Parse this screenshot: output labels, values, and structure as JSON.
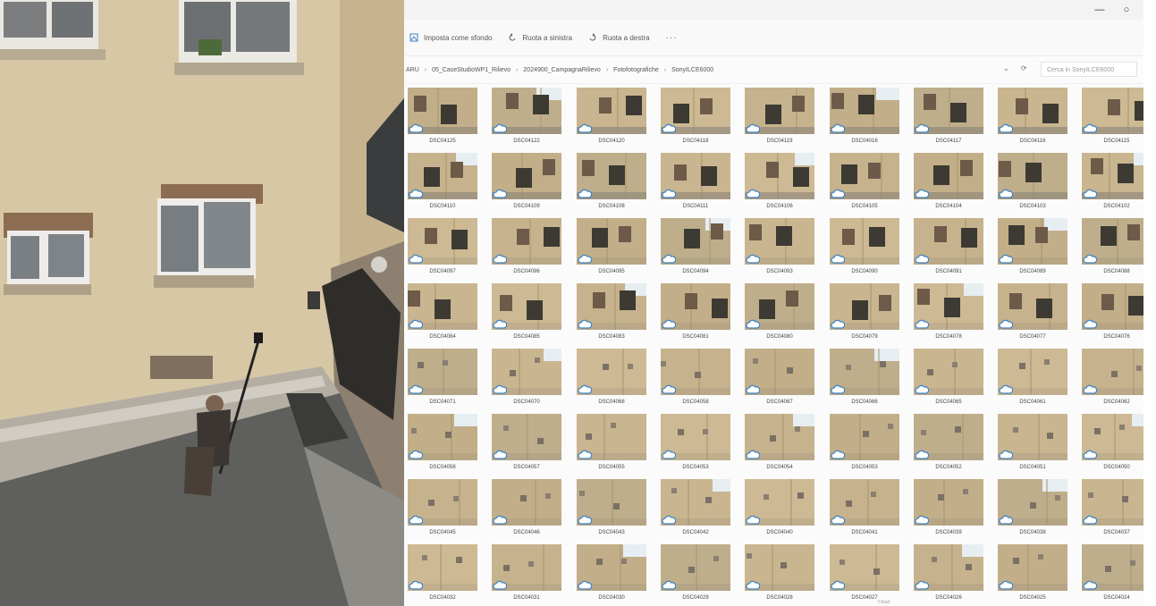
{
  "window": {
    "minimize_icon": "minimize-icon",
    "maximize_icon": "maximize-icon"
  },
  "toolbar": {
    "items": [
      {
        "label": "Imposta come sfondo",
        "icon": "wallpaper-icon"
      },
      {
        "label": "Ruota a sinistra",
        "icon": "rotate-left-icon"
      },
      {
        "label": "Ruota a destra",
        "icon": "rotate-right-icon"
      }
    ],
    "more": "···"
  },
  "breadcrumb": [
    "ARU",
    "05_CaseStudioWP1_Rilievo",
    "2024900_CampagnaRilievo",
    "Fotofotografiche",
    "SonyILCE6000"
  ],
  "search": {
    "placeholder": "Cerca in SonyILCE6000"
  },
  "colors": {
    "wall": "#c9b58f",
    "wall_dark": "#a8956c",
    "window_dark": "#3d3a33",
    "cloud": "#3b82c4",
    "sky": "#e6eef2"
  },
  "files": [
    "DSC04125",
    "DSC04122",
    "DSC04120",
    "DSC04118",
    "DSC04119",
    "DSC04016",
    "DSC04117",
    "DSC04116",
    "DSC04115",
    "DSC04110",
    "DSC04109",
    "DSC04108",
    "DSC04111",
    "DSC04106",
    "DSC04105",
    "DSC04104",
    "DSC04103",
    "DSC04102",
    "DSC04097",
    "DSC04096",
    "DSC04095",
    "DSC04094",
    "DSC04093",
    "DSC04090",
    "DSC04091",
    "DSC04089",
    "DSC04088",
    "DSC04084",
    "DSC04085",
    "DSC04083",
    "DSC04081",
    "DSC04080",
    "DSC04079",
    "DSC04078",
    "DSC04077",
    "DSC04076",
    "DSC04071",
    "DSC04070",
    "DSC04068",
    "DSC04058",
    "DSC04067",
    "DSC04066",
    "DSC04065",
    "DSC04061",
    "DSC04062",
    "DSC04058",
    "DSC04057",
    "DSC04055",
    "DSC04053",
    "DSC04054",
    "DSC04053",
    "DSC04052",
    "DSC04051",
    "DSC04050",
    "DSC04045",
    "DSC04046",
    "DSC04043",
    "DSC04042",
    "DSC04040",
    "DSC04041",
    "DSC04039",
    "DSC04038",
    "DSC04037",
    "DSC04032",
    "DSC04031",
    "DSC04030",
    "DSC04029",
    "DSC04028",
    "DSC04027",
    "DSC04026",
    "DSC04025",
    "DSC04024"
  ],
  "status": {
    "stub": "Cloud"
  }
}
